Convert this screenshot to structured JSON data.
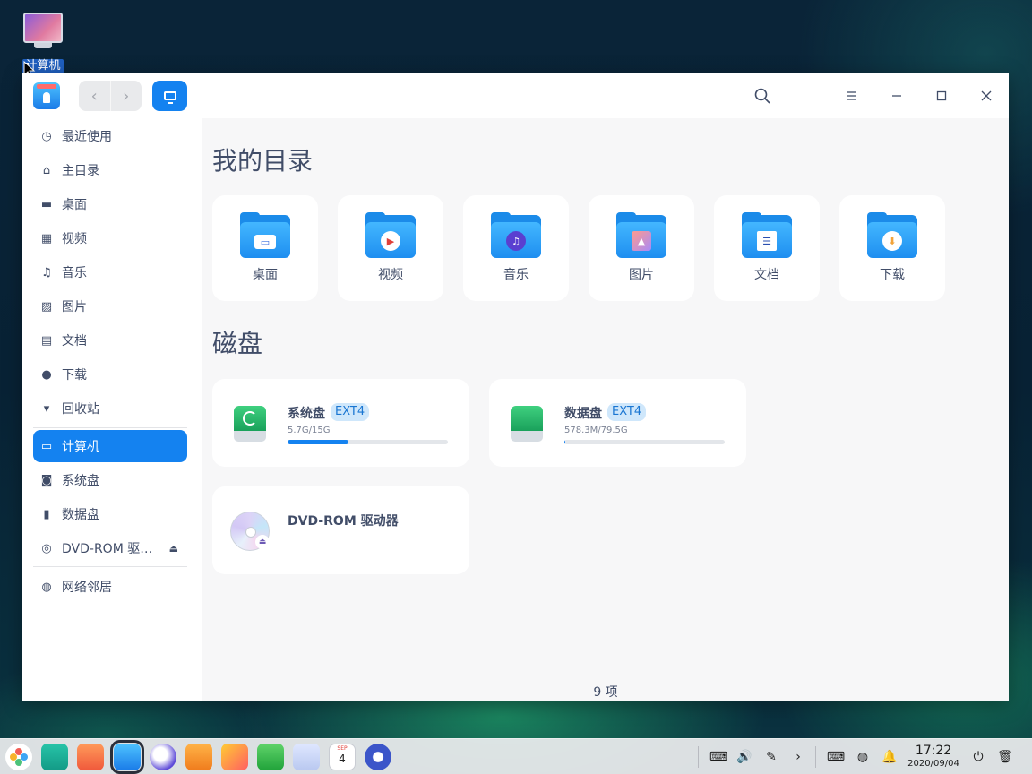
{
  "desktop": {
    "computer_icon_label": "计算机"
  },
  "window": {
    "nav": {
      "back": "‹",
      "forward": "›"
    },
    "sidebar": {
      "items": [
        {
          "label": "最近使用",
          "icon": "clock-icon"
        },
        {
          "label": "主目录",
          "icon": "home-icon"
        },
        {
          "label": "桌面",
          "icon": "desktop-icon"
        },
        {
          "label": "视频",
          "icon": "video-icon"
        },
        {
          "label": "音乐",
          "icon": "music-icon"
        },
        {
          "label": "图片",
          "icon": "picture-icon"
        },
        {
          "label": "文档",
          "icon": "document-icon"
        },
        {
          "label": "下载",
          "icon": "download-icon"
        },
        {
          "label": "回收站",
          "icon": "trash-icon"
        },
        {
          "label": "计算机",
          "icon": "computer-icon",
          "active": true
        },
        {
          "label": "系统盘",
          "icon": "disk-icon"
        },
        {
          "label": "数据盘",
          "icon": "disk-icon"
        },
        {
          "label": "DVD-ROM 驱…",
          "icon": "dvd-icon"
        },
        {
          "label": "网络邻居",
          "icon": "network-icon"
        }
      ]
    },
    "main": {
      "my_dirs_title": "我的目录",
      "folders": [
        {
          "label": "桌面",
          "icon": "desktop-folder-icon"
        },
        {
          "label": "视频",
          "icon": "video-folder-icon"
        },
        {
          "label": "音乐",
          "icon": "music-folder-icon"
        },
        {
          "label": "图片",
          "icon": "picture-folder-icon"
        },
        {
          "label": "文档",
          "icon": "document-folder-icon"
        },
        {
          "label": "下载",
          "icon": "download-folder-icon"
        }
      ],
      "disks_title": "磁盘",
      "disks": [
        {
          "name": "系统盘",
          "fs": "EXT4",
          "usage": "5.7G/15G",
          "fraction": 0.38
        },
        {
          "name": "数据盘",
          "fs": "EXT4",
          "usage": "578.3M/79.5G",
          "fraction": 0.007
        }
      ],
      "dvd": {
        "name": "DVD-ROM 驱动器"
      },
      "status": "9 项"
    }
  },
  "taskbar": {
    "time": "17:22",
    "date": "2020/09/04",
    "calendar_month": "SEP",
    "calendar_day": "4"
  },
  "colors": {
    "accent": "#1482f0",
    "text": "#414d68"
  }
}
